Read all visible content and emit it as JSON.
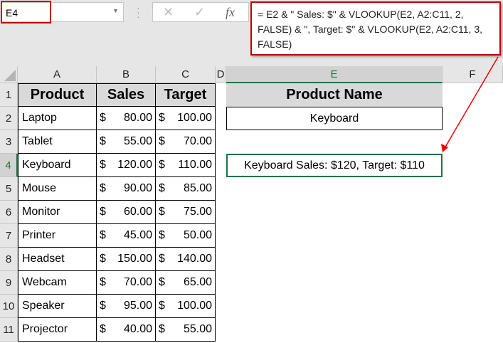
{
  "name_box": "E4",
  "formula_bar": {
    "cancel_icon": "✕",
    "enter_icon": "✓",
    "fx_label": "fx",
    "formula": "= E2 & \" Sales: $\" & VLOOKUP(E2, A2:C11, 2, FALSE) & \", Target: $\" & VLOOKUP(E2, A2:C11, 3, FALSE)"
  },
  "columns": [
    "A",
    "B",
    "C",
    "D",
    "E",
    "F"
  ],
  "rows": [
    "1",
    "2",
    "3",
    "4",
    "5",
    "6",
    "7",
    "8",
    "9",
    "10",
    "11"
  ],
  "table": {
    "headers": [
      "Product",
      "Sales",
      "Target"
    ],
    "data": [
      [
        "Laptop",
        "80.00",
        "100.00"
      ],
      [
        "Tablet",
        "55.00",
        "70.00"
      ],
      [
        "Keyboard",
        "120.00",
        "110.00"
      ],
      [
        "Mouse",
        "90.00",
        "85.00"
      ],
      [
        "Monitor",
        "60.00",
        "75.00"
      ],
      [
        "Printer",
        "45.00",
        "50.00"
      ],
      [
        "Headset",
        "150.00",
        "140.00"
      ],
      [
        "Webcam",
        "70.00",
        "65.00"
      ],
      [
        "Speaker",
        "95.00",
        "100.00"
      ],
      [
        "Projector",
        "40.00",
        "55.00"
      ]
    ]
  },
  "currency": "$",
  "lookup": {
    "header": "Product Name",
    "value": "Keyboard",
    "result": "Keyboard Sales: $120, Target: $110"
  },
  "colors": {
    "accent": "#217346",
    "annotation": "#c00000"
  }
}
